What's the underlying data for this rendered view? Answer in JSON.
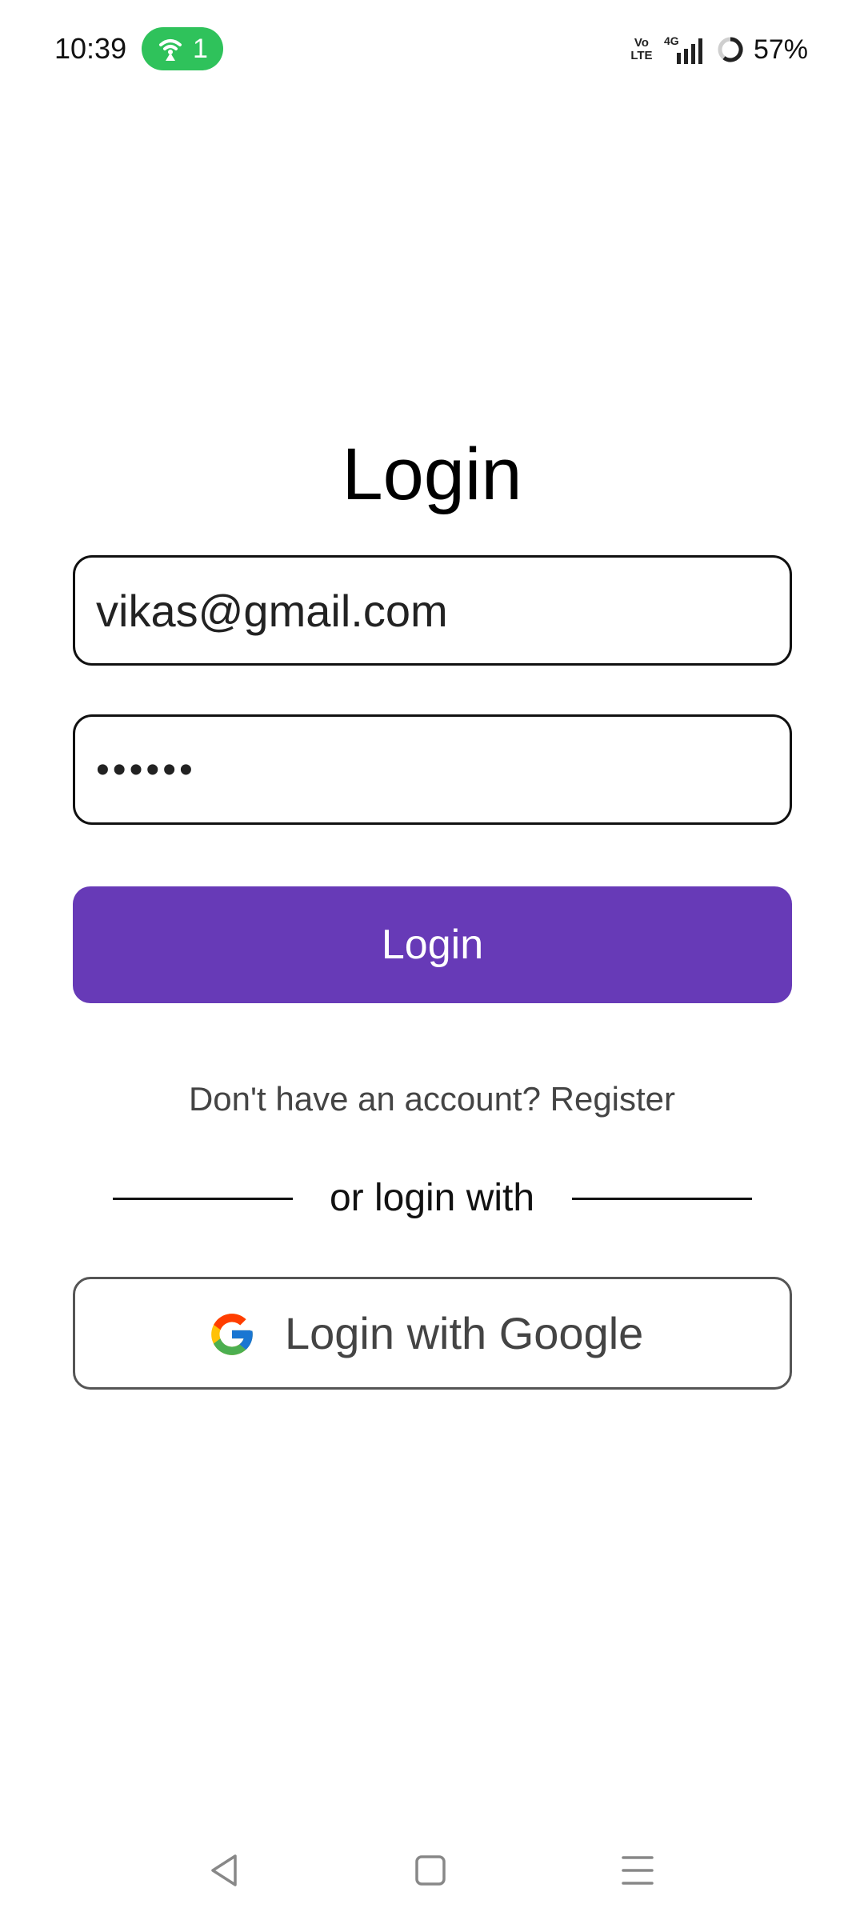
{
  "status_bar": {
    "time": "10:39",
    "hotspot_count": "1",
    "volte": [
      "Vo",
      "LTE"
    ],
    "network": "4G",
    "battery": "57%",
    "hotspot_color": "#2fc25b"
  },
  "login": {
    "title": "Login",
    "email_value": "vikas@gmail.com",
    "password_value": "••••••",
    "login_button": "Login",
    "register_text": "Don't have an account? Register",
    "divider_text": "or login with",
    "google_button": "Login with Google",
    "accent_color": "#673ab7"
  },
  "icons": {
    "hotspot": "hotspot-icon",
    "signal": "signal-icon",
    "battery": "battery-icon",
    "google": "google-icon",
    "back": "back-icon",
    "home": "home-icon",
    "recents": "recents-icon"
  }
}
